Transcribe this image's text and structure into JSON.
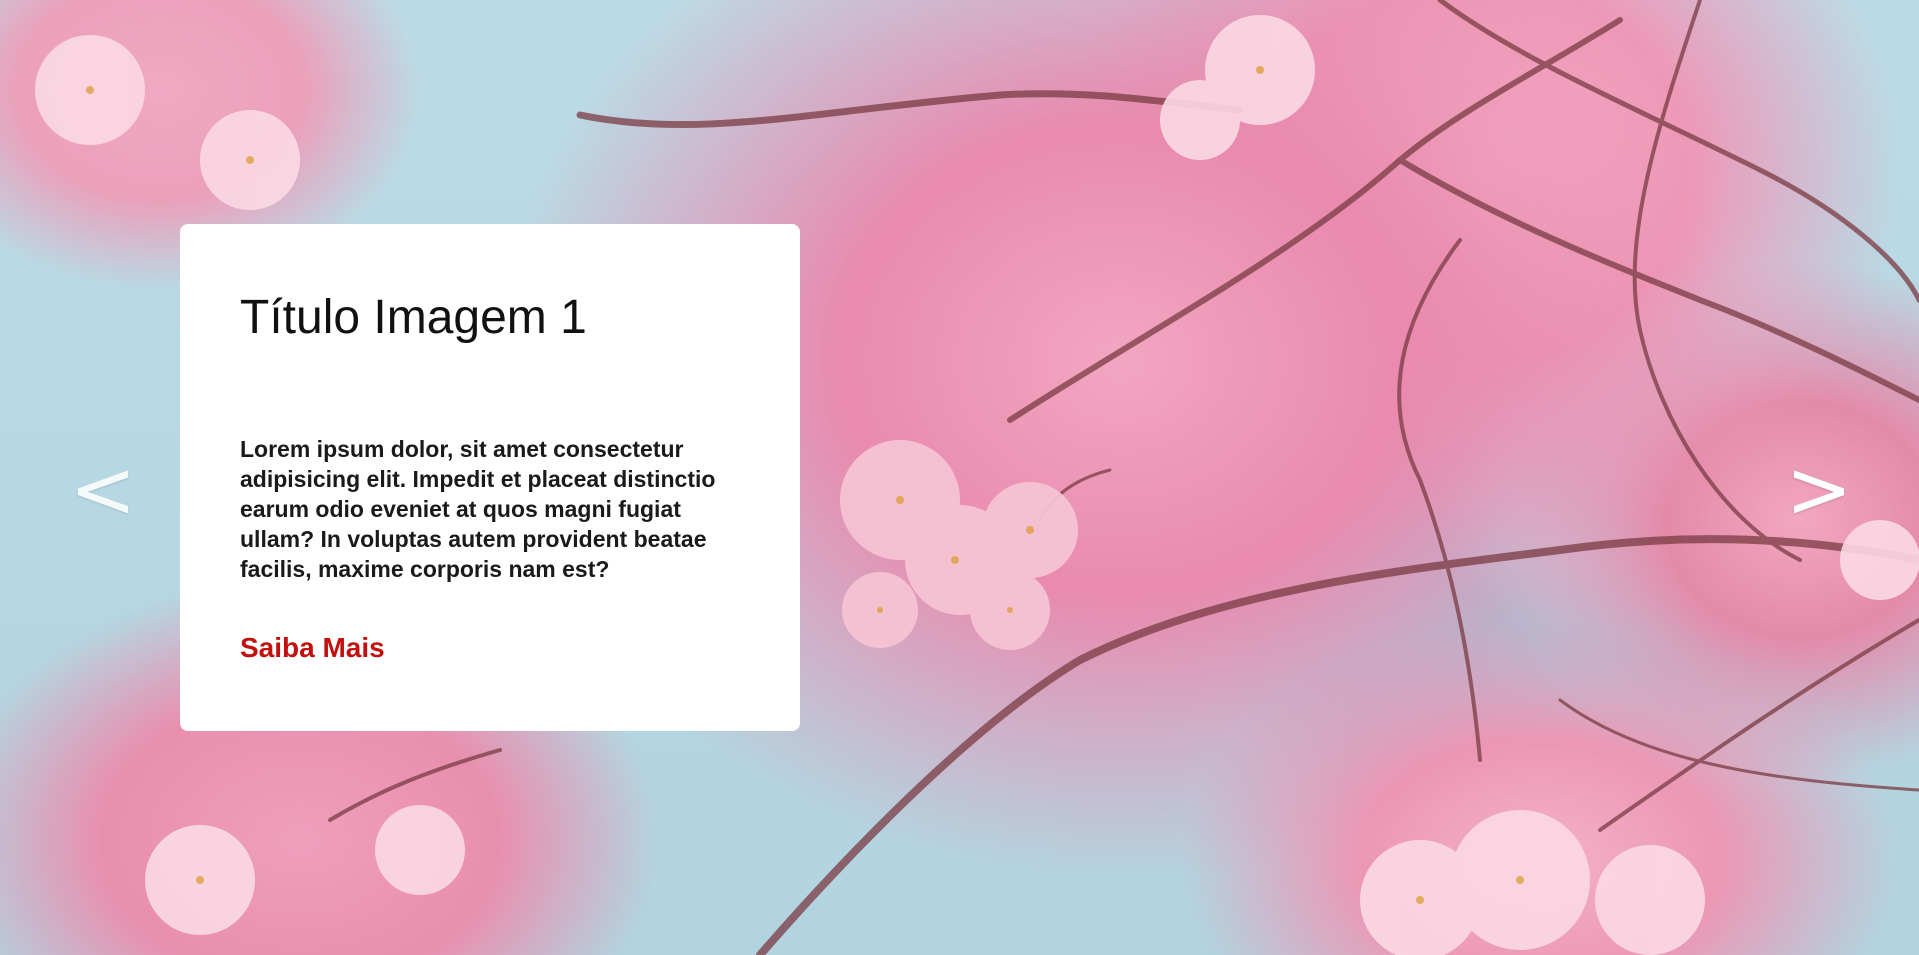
{
  "slide": {
    "title": "Título Imagem 1",
    "text": "Lorem ipsum dolor, sit amet consectetur adipisicing elit. Impedit et placeat distinctio earum odio eveniet at quos magni fugiat ullam? In voluptas autem provident beatae facilis, maxime corporis nam est?",
    "link_label": "Saiba Mais"
  },
  "nav": {
    "prev_symbol": "<",
    "next_symbol": ">"
  },
  "colors": {
    "link": "#c2100e",
    "card_bg": "#ffffff",
    "sky": "#bcdbe6",
    "blossom": "#ec97b4"
  },
  "background_image": "pink-cherry-blossom-photo"
}
